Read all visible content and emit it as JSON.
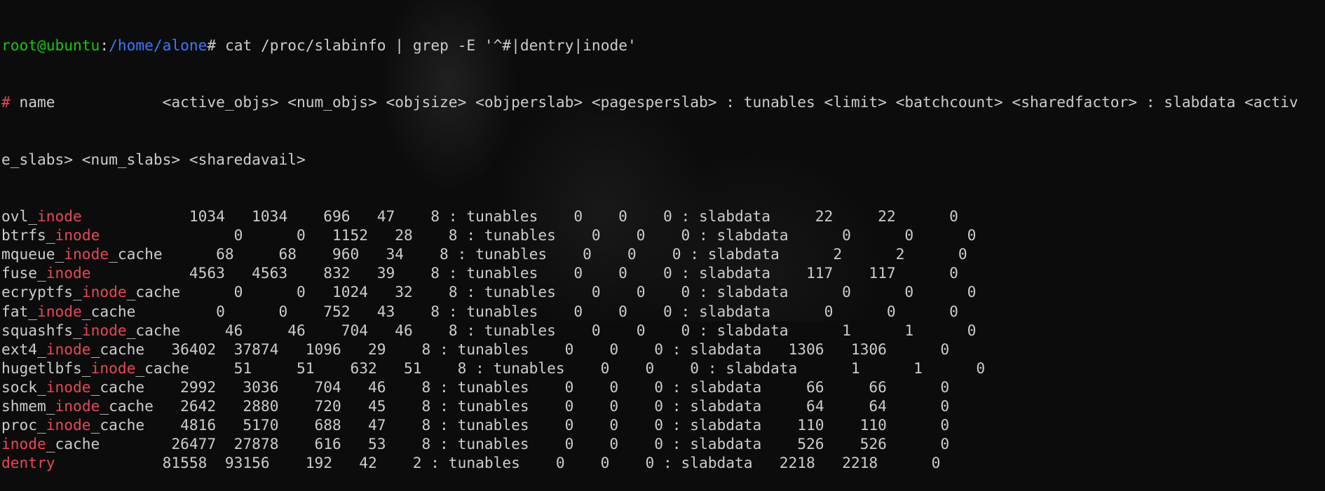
{
  "prompt": {
    "user_host": "root@ubuntu",
    "colon": ":",
    "path": "/home/alone",
    "symbol": "#",
    "command": " cat /proc/slabinfo | grep -E '^#|dentry|inode'"
  },
  "header": {
    "hash": "#",
    "line1_rest": " name            <active_objs> <num_objs> <objsize> <objperslab> <pagesperslab> : tunables <limit> <batchcount> <sharedfactor> : slabdata <activ",
    "line2": "e_slabs> <num_slabs> <sharedavail>"
  },
  "rows": [
    {
      "pre": "ovl_",
      "match": "inode",
      "post": "",
      "rest": "            1034   1034    696   47    8 : tunables    0    0    0 : slabdata     22     22      0"
    },
    {
      "pre": "btrfs_",
      "match": "inode",
      "post": "",
      "rest": "               0      0   1152   28    8 : tunables    0    0    0 : slabdata      0      0      0"
    },
    {
      "pre": "mqueue_",
      "match": "inode",
      "post": "_cache",
      "rest": "      68     68    960   34    8 : tunables    0    0    0 : slabdata      2      2      0"
    },
    {
      "pre": "fuse_",
      "match": "inode",
      "post": "",
      "rest": "           4563   4563    832   39    8 : tunables    0    0    0 : slabdata    117    117      0"
    },
    {
      "pre": "ecryptfs_",
      "match": "inode",
      "post": "_cache",
      "rest": "      0      0   1024   32    8 : tunables    0    0    0 : slabdata      0      0      0"
    },
    {
      "pre": "fat_",
      "match": "inode",
      "post": "_cache",
      "rest": "         0      0    752   43    8 : tunables    0    0    0 : slabdata      0      0      0"
    },
    {
      "pre": "squashfs_",
      "match": "inode",
      "post": "_cache",
      "rest": "     46     46    704   46    8 : tunables    0    0    0 : slabdata      1      1      0"
    },
    {
      "pre": "ext4_",
      "match": "inode",
      "post": "_cache",
      "rest": "   36402  37874   1096   29    8 : tunables    0    0    0 : slabdata   1306   1306      0"
    },
    {
      "pre": "hugetlbfs_",
      "match": "inode",
      "post": "_cache",
      "rest": "     51     51    632   51    8 : tunables    0    0    0 : slabdata      1      1      0"
    },
    {
      "pre": "sock_",
      "match": "inode",
      "post": "_cache",
      "rest": "    2992   3036    704   46    8 : tunables    0    0    0 : slabdata     66     66      0"
    },
    {
      "pre": "shmem_",
      "match": "inode",
      "post": "_cache",
      "rest": "   2642   2880    720   45    8 : tunables    0    0    0 : slabdata     64     64      0"
    },
    {
      "pre": "proc_",
      "match": "inode",
      "post": "_cache",
      "rest": "    4816   5170    688   47    8 : tunables    0    0    0 : slabdata    110    110      0"
    },
    {
      "pre": "",
      "match": "inode",
      "post": "_cache",
      "rest": "        26477  27878    616   53    8 : tunables    0    0    0 : slabdata    526    526      0"
    },
    {
      "pre": "",
      "match": "dentry",
      "post": "",
      "rest": "            81558  93156    192   42    2 : tunables    0    0    0 : slabdata   2218   2218      0"
    }
  ],
  "colors": {
    "prompt_user": "#16c60c",
    "prompt_path": "#3b78ff",
    "match": "#e74856",
    "text": "#cccccc",
    "background": "#0c0c0c"
  }
}
